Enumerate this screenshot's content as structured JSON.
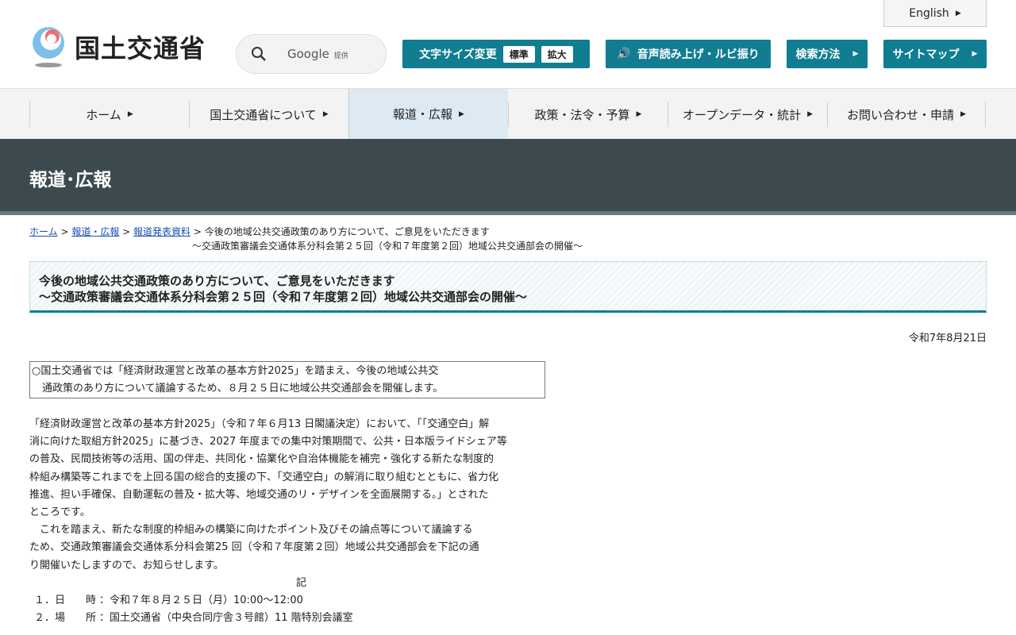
{
  "header": {
    "logo_text": "国土交通省",
    "english": "English",
    "search_provider": "Google",
    "search_provided": "提供",
    "font_size_label": "文字サイズ変更",
    "font_standard": "標準",
    "font_large": "拡大",
    "speech": "音声読み上げ・ルビ振り",
    "search_method": "検索方法",
    "sitemap": "サイトマップ"
  },
  "nav": [
    "ホーム",
    "国土交通省について",
    "報道・広報",
    "政策・法令・予算",
    "オープンデータ・統計",
    "お問い合わせ・申請"
  ],
  "banner": "報道･広報",
  "breadcrumb": {
    "home": "ホーム",
    "press": "報道・広報",
    "releases": "報道発表資料",
    "current1": "今後の地域公共交通政策のあり方について、ご意見をいただきます",
    "current2": "～交通政策審議会交通体系分科会第２５回（令和７年度第２回）地域公共交通部会の開催～"
  },
  "title": {
    "line1": "今後の地域公共交通政策のあり方について、ご意見をいただきます",
    "line2": "～交通政策審議会交通体系分科会第２５回（令和７年度第２回）地域公共交通部会の開催～"
  },
  "date": "令和7年8月21日",
  "summary": {
    "line1": "○国土交通省では「経済財政運営と改革の基本方針2025」を踏まえ、今後の地域公共交",
    "line2": "　通政策のあり方について議論するため、８月２５日に地域公共交通部会を開催します。"
  },
  "body": [
    "「経済財政運営と改革の基本方針2025」（令和７年６月13 日閣議決定）において、「「交通空白」解",
    "消に向けた取組方針2025」に基づき、2027 年度までの集中対策期間で、公共・日本版ライドシェア等",
    "の普及、民間技術等の活用、国の伴走、共同化・協業化や自治体機能を補完・強化する新たな制度的",
    "枠組み構築等これまでを上回る国の総合的支援の下、「交通空白」の解消に取り組むとともに、省力化",
    "推進、担い手確保、自動運転の普及・拡大等、地域交通のリ・デザインを全面展開する。」とされた",
    "ところです。",
    "　これを踏まえ、新たな制度的枠組みの構築に向けたポイント及びその論点等について議論する",
    "ため、交通政策審議会交通体系分科会第25 回（令和７年度第２回）地域公共交通部会を下記の通",
    "り開催いたしますので、お知らせします。"
  ],
  "ki": "記",
  "details": [
    {
      "num": "１．",
      "label": "日　　時",
      "value": "：令和７年８月２５日（月）10:00～12:00"
    },
    {
      "num": "２．",
      "label": "場　　所",
      "value": "：国土交通省（中央合同庁舎３号館）11 階特別会議室"
    }
  ],
  "colors": {
    "accent": "#107d91",
    "banner": "#3c4a50"
  }
}
